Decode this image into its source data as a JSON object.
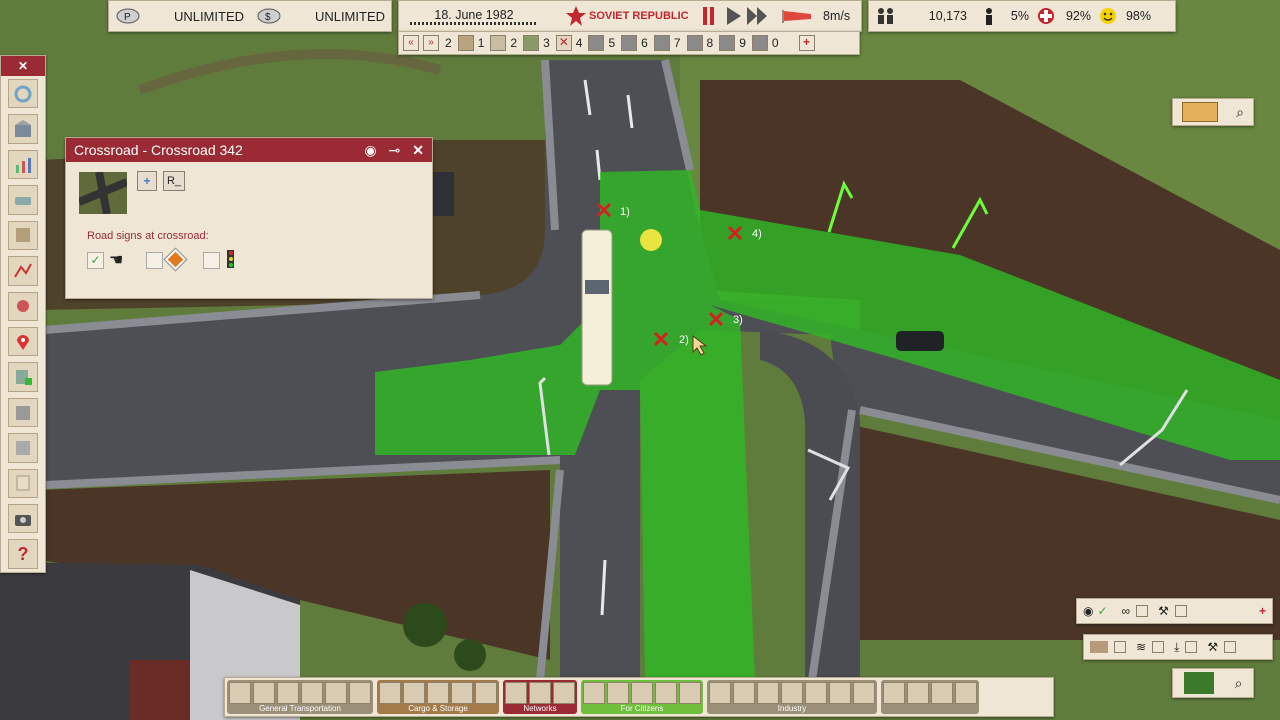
{
  "resources": {
    "money_rubles": "UNLIMITED",
    "money_dollars": "UNLIMITED",
    "icons": [
      "ruble-coin-icon",
      "dollar-coin-icon"
    ]
  },
  "date": "18. June 1982",
  "logo": "SOVIET REPUBLIC",
  "wind": "8m/s",
  "stats": {
    "population": "10,173",
    "unemployment": "5%",
    "health": "92%",
    "happiness": "98%"
  },
  "speedbar": {
    "items": [
      "2",
      "1",
      "2",
      "3",
      "4",
      "5",
      "6",
      "7",
      "8",
      "9",
      "0"
    ]
  },
  "crossroad_window": {
    "title": "Crossroad - Crossroad 342",
    "r_button": "R_",
    "road_signs_label": "Road signs at crossroad:"
  },
  "waypoints": [
    "1)",
    "2)",
    "3)",
    "4)"
  ],
  "bottom_groups": [
    {
      "label": "General Transportation",
      "color": "#9c8f78",
      "count": 6
    },
    {
      "label": "Cargo & Storage",
      "color": "#a37a4a",
      "count": 5
    },
    {
      "label": "Networks",
      "color": "#9a2b35",
      "count": 3
    },
    {
      "label": "For Citizens",
      "color": "#6fbe3c",
      "count": 5
    },
    {
      "label": "Industry",
      "color": "#9c8f78",
      "count": 7
    },
    {
      "label": "",
      "color": "#9c8f78",
      "count": 4
    }
  ],
  "colors": {
    "accent_red": "#9a2b35",
    "selection_green": "#2fb824",
    "panel_bg": "#efe6d6"
  }
}
